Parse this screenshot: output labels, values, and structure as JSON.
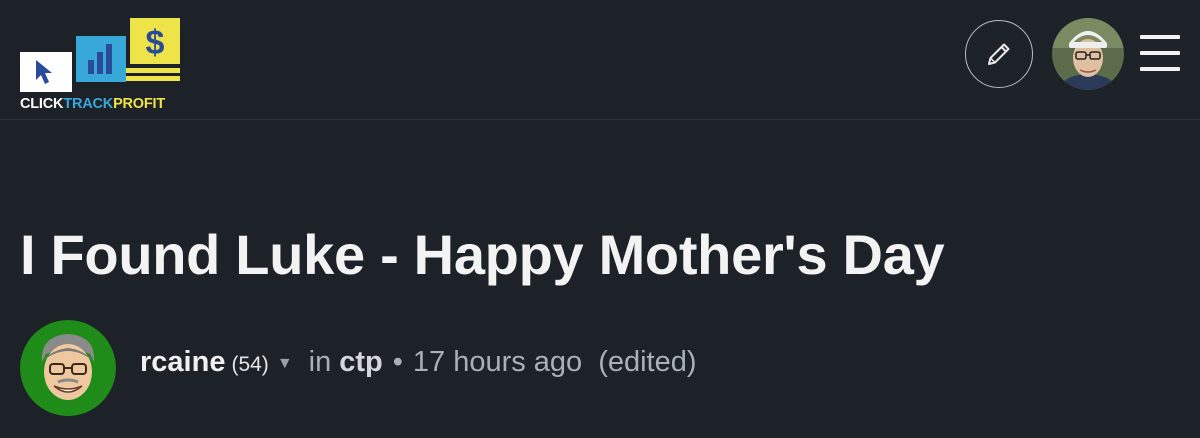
{
  "header": {
    "logo": {
      "text_part1": "CLICK",
      "text_part2": "TRACK",
      "text_part3": "PROFIT",
      "colors": {
        "white": "#ffffff",
        "blue": "#37a8d8",
        "yellow": "#efe34a",
        "dark_blue": "#2a4a9a"
      }
    },
    "edit_icon": "pencil-icon",
    "user_avatar": "user-avatar",
    "menu_icon": "hamburger-menu-icon"
  },
  "post": {
    "title": "I Found Luke - Happy Mother's Day",
    "author": "rcaine",
    "reputation": "(54)",
    "caret_icon": "chevron-down-icon",
    "in_label": "in",
    "community": "ctp",
    "separator": "•",
    "time_ago": "17 hours ago",
    "edited_label": "(edited)"
  },
  "colors": {
    "background": "#1d2128",
    "title_text": "#f3f3f3",
    "meta_text": "#aab0b8",
    "author_avatar_bg": "#1f8c1a"
  }
}
